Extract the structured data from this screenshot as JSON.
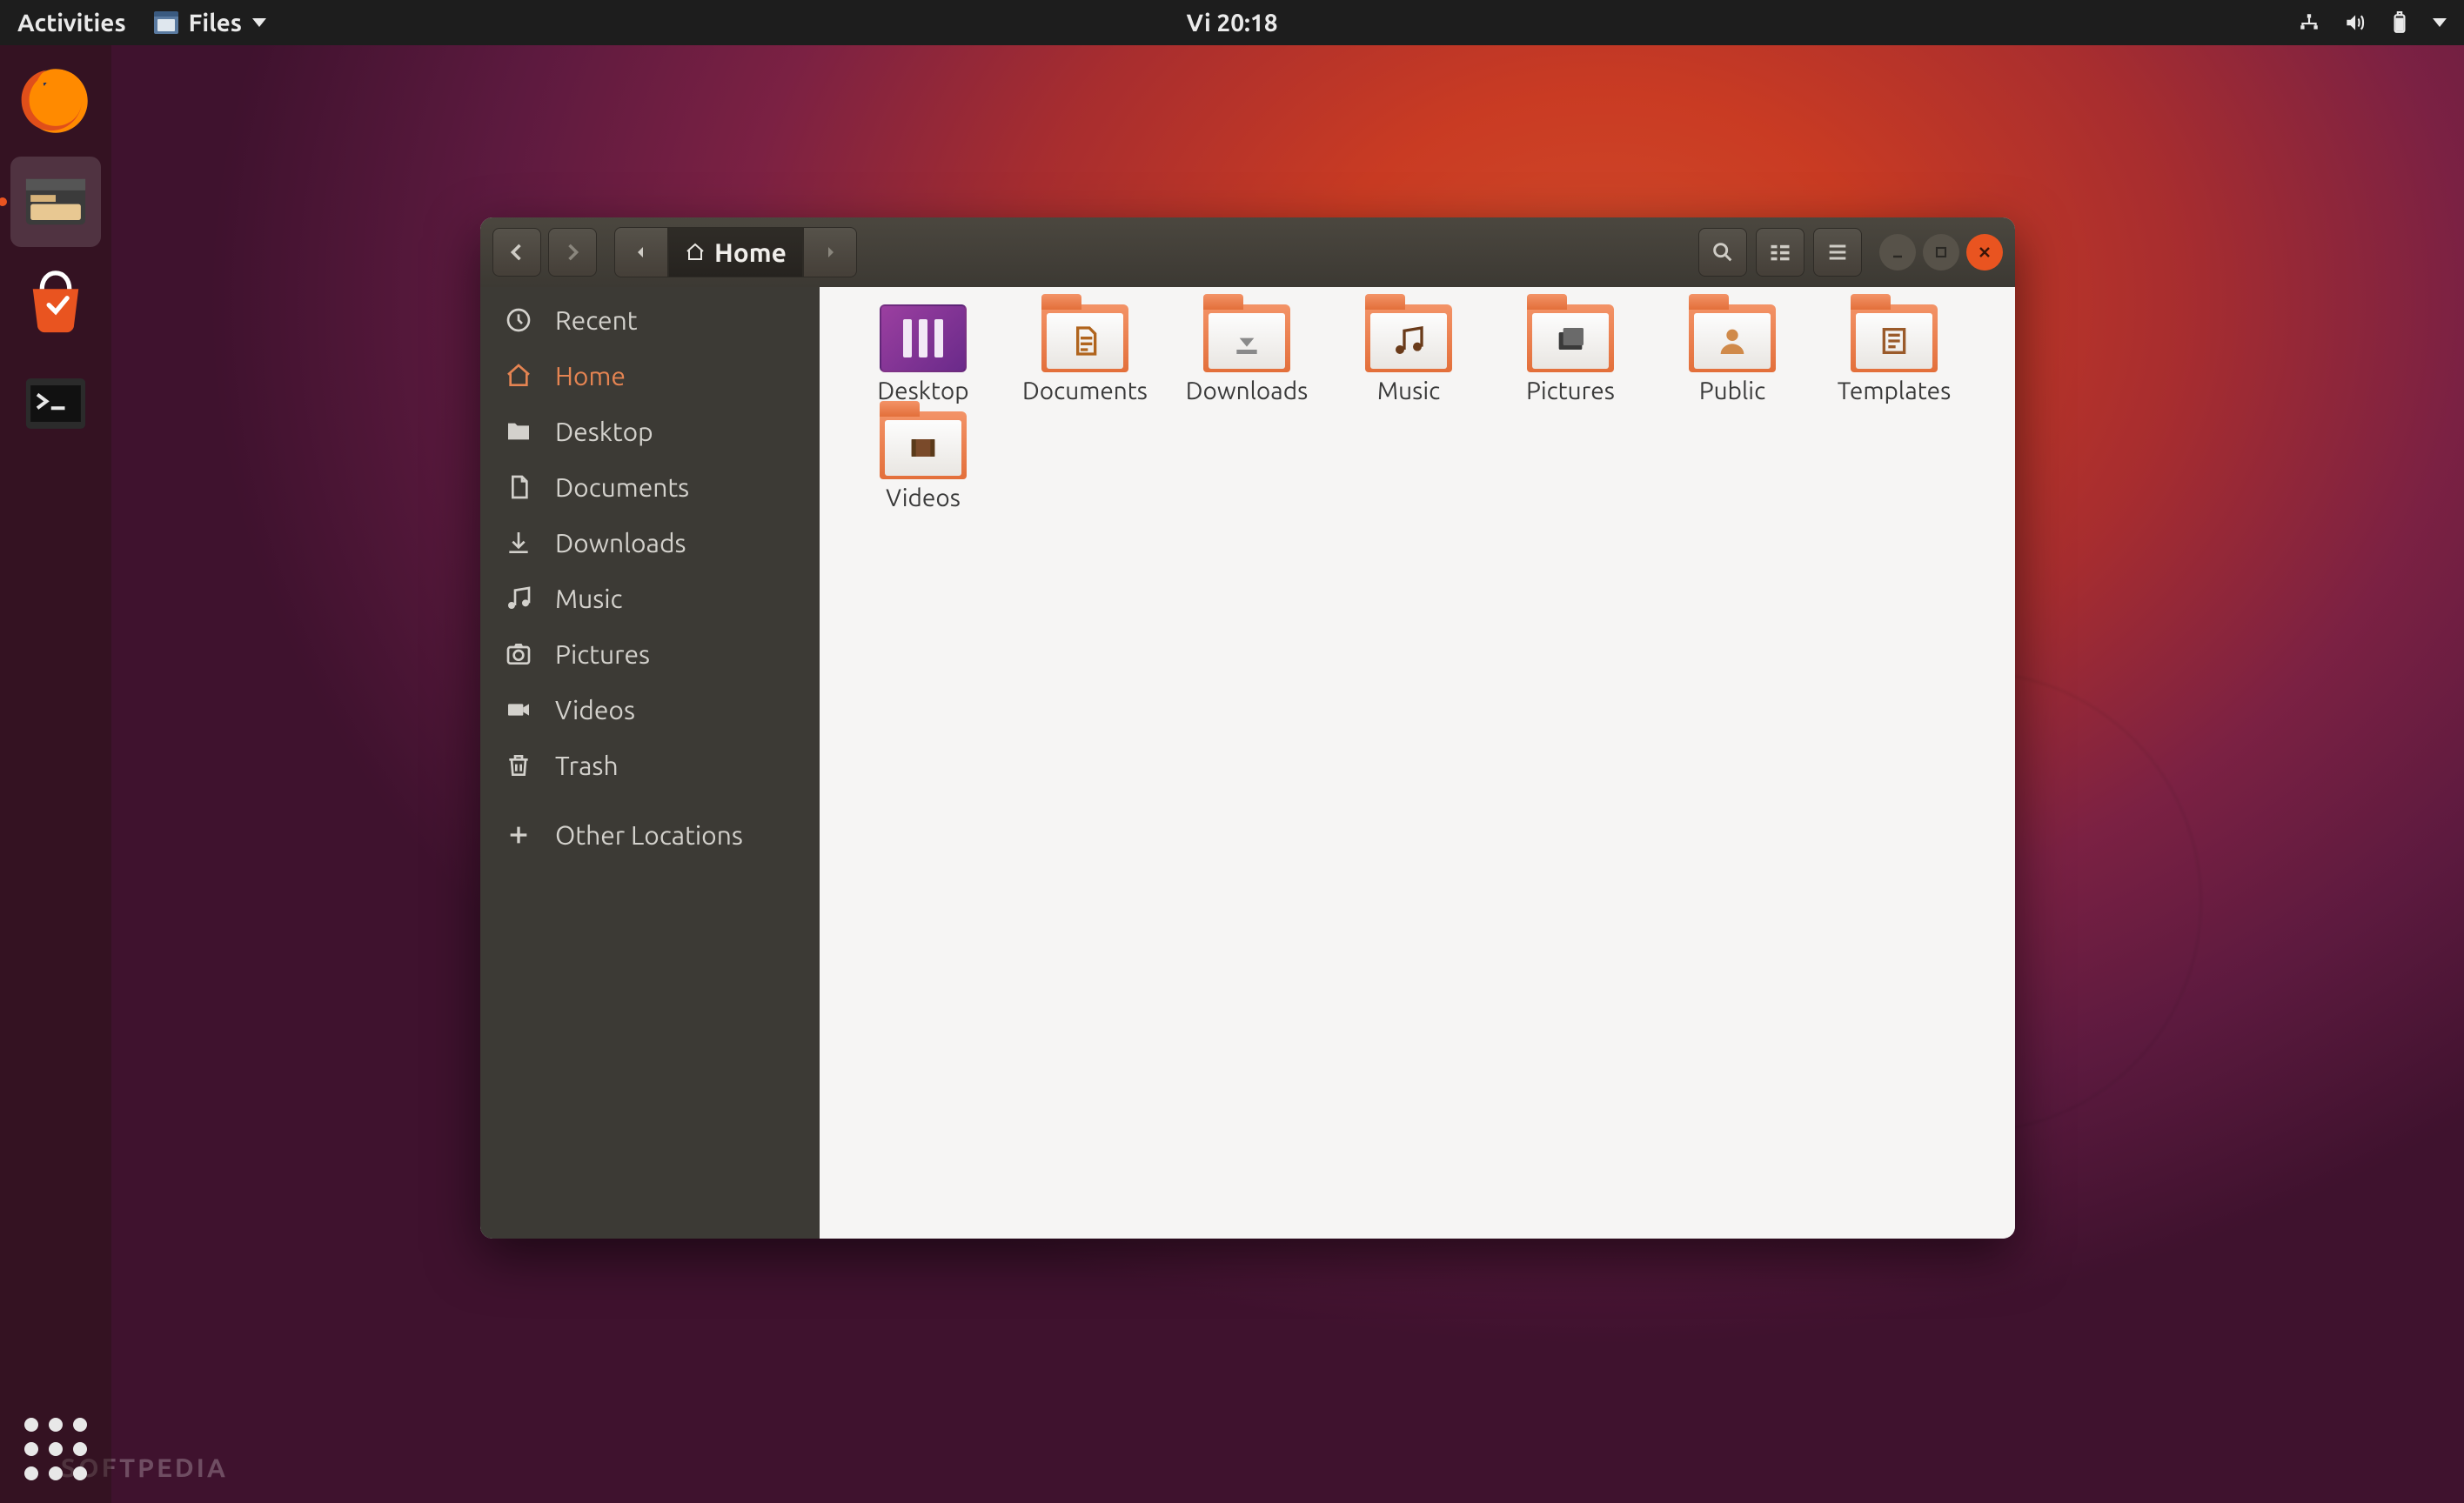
{
  "topbar": {
    "activities": "Activities",
    "app_menu": "Files",
    "clock": "Vi 20:18"
  },
  "dock": {
    "items": [
      {
        "name": "firefox"
      },
      {
        "name": "files",
        "active": true
      },
      {
        "name": "software"
      },
      {
        "name": "terminal"
      }
    ]
  },
  "window": {
    "path_current": "Home",
    "sidebar": [
      {
        "icon": "clock",
        "label": "Recent"
      },
      {
        "icon": "home",
        "label": "Home",
        "active": true
      },
      {
        "icon": "desktop",
        "label": "Desktop"
      },
      {
        "icon": "document",
        "label": "Documents"
      },
      {
        "icon": "download",
        "label": "Downloads"
      },
      {
        "icon": "music",
        "label": "Music"
      },
      {
        "icon": "camera",
        "label": "Pictures"
      },
      {
        "icon": "video",
        "label": "Videos"
      },
      {
        "icon": "trash",
        "label": "Trash"
      },
      {
        "icon": "plus",
        "label": "Other Locations",
        "separator_before": true
      }
    ],
    "files": [
      {
        "label": "Desktop",
        "kind": "desktop"
      },
      {
        "label": "Documents",
        "kind": "folder",
        "glyph": "doc"
      },
      {
        "label": "Downloads",
        "kind": "folder",
        "glyph": "download"
      },
      {
        "label": "Music",
        "kind": "folder",
        "glyph": "music"
      },
      {
        "label": "Pictures",
        "kind": "folder",
        "glyph": "pictures"
      },
      {
        "label": "Public",
        "kind": "folder",
        "glyph": "public"
      },
      {
        "label": "Templates",
        "kind": "folder",
        "glyph": "templates"
      },
      {
        "label": "Videos",
        "kind": "folder",
        "glyph": "video"
      }
    ]
  },
  "watermark": "SOFTPEDIA",
  "colors": {
    "accent": "#e95420",
    "sidebar": "#3c3a35",
    "titlebar": "#3c3933"
  }
}
